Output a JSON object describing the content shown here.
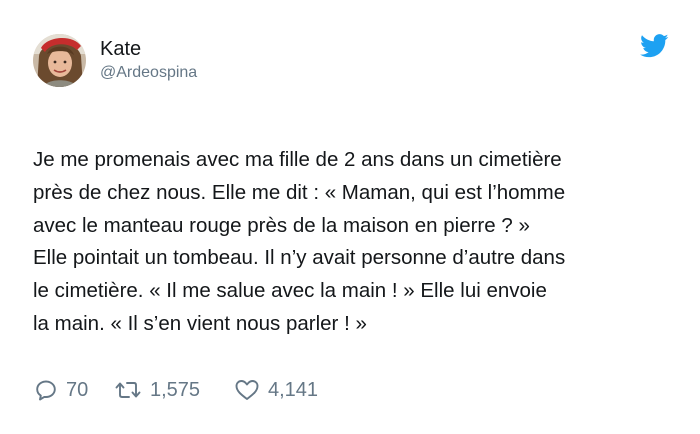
{
  "user": {
    "display_name": "Kate",
    "handle": "@Ardeospina",
    "avatar_icon": "avatar-photo"
  },
  "brand": {
    "icon": "twitter-bird-icon",
    "color": "#1da1f2"
  },
  "tweet": {
    "lines": [
      "Je me promenais avec ma fille de 2 ans dans un cimetière",
      "près de chez nous. Elle me dit : « Maman, qui est l’homme",
      "avec le manteau rouge près de la maison en pierre ? »",
      "Elle pointait un tombeau. Il n’y avait personne d’autre dans",
      "le cimetière. « Il me salue avec la main ! » Elle lui envoie",
      "la main. « Il s’en vient nous parler ! »"
    ]
  },
  "actions": {
    "replies": "70",
    "retweets": "1,575",
    "likes": "4,141",
    "icon_color": "#657786"
  }
}
